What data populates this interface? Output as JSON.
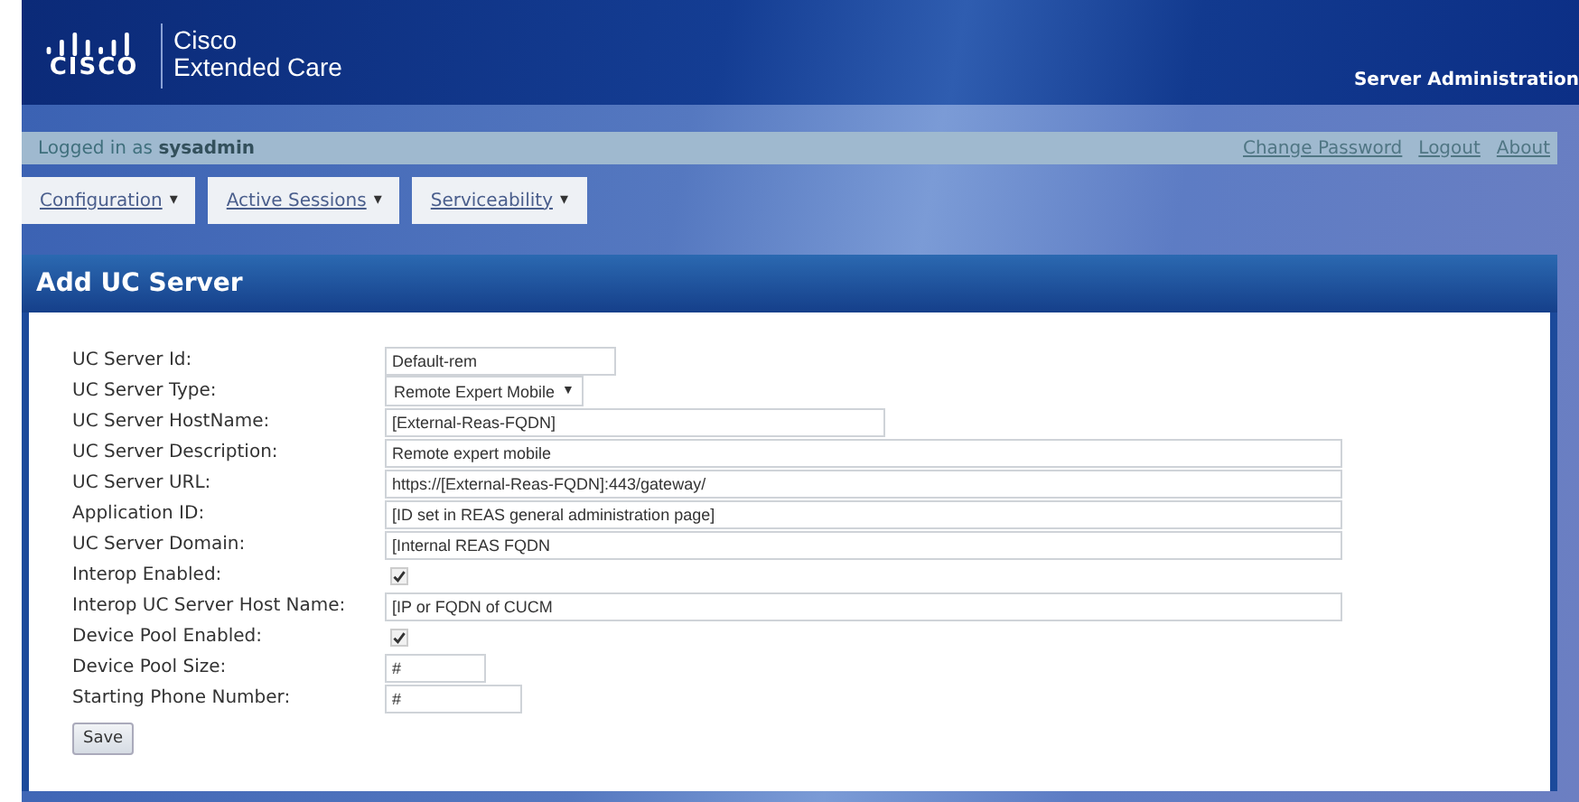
{
  "header": {
    "brand": "CISCO",
    "product_line1": "Cisco",
    "product_line2": "Extended Care",
    "section": "Server Administration"
  },
  "user_bar": {
    "prefix": "Logged in as",
    "user": "sysadmin",
    "links": [
      "Change Password",
      "Logout",
      "About"
    ]
  },
  "menus": [
    {
      "label": "Configuration",
      "caret": "▾"
    },
    {
      "label": "Active Sessions",
      "caret": "▾"
    },
    {
      "label": "Serviceability",
      "caret": "▾"
    }
  ],
  "panel": {
    "title": "Add UC Server",
    "fields": [
      {
        "label": "UC Server Id:",
        "kind": "shorttext",
        "value": "Default-rem"
      },
      {
        "label": "UC Server Type:",
        "kind": "select",
        "value": "Remote Expert Mobile",
        "caret": "▼"
      },
      {
        "label": "UC Server HostName:",
        "kind": "text",
        "value": "[External-Reas-FQDN]"
      },
      {
        "label": "UC Server Description:",
        "kind": "longtext",
        "value": "Remote expert mobile"
      },
      {
        "label": "UC Server URL:",
        "kind": "longtext",
        "value": "https://[External-Reas-FQDN]:443/gateway/"
      },
      {
        "label": "Application ID:",
        "kind": "longtext",
        "value": "[ID set in REAS general administration page]"
      },
      {
        "label": "UC Server Domain:",
        "kind": "longtext",
        "value": "[Internal REAS FQDN"
      },
      {
        "label": "Interop Enabled:",
        "kind": "checkbox",
        "checked": true
      },
      {
        "label": "Interop UC Server Host Name:",
        "kind": "longtext",
        "value": "[IP or FQDN of CUCM"
      },
      {
        "label": "Device Pool Enabled:",
        "kind": "checkbox",
        "checked": true
      },
      {
        "label": "Device Pool Size:",
        "kind": "tinytext",
        "value": "#"
      },
      {
        "label": "Starting Phone Number:",
        "kind": "smalltext",
        "value": "#"
      }
    ],
    "button": "Save"
  }
}
